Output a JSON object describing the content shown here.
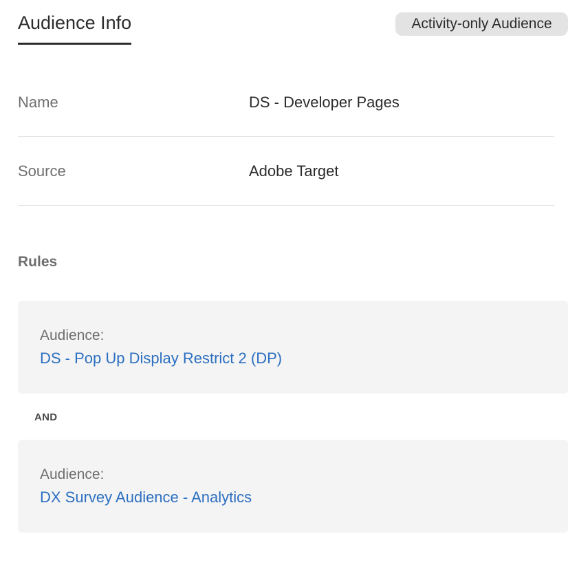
{
  "tab": {
    "label": "Audience Info"
  },
  "badge": {
    "label": "Activity-only Audience"
  },
  "details": {
    "rows": [
      {
        "label": "Name",
        "value": "DS - Developer Pages"
      },
      {
        "label": "Source",
        "value": "Adobe Target"
      }
    ]
  },
  "rules": {
    "heading": "Rules",
    "operator": "AND",
    "items": [
      {
        "label": "Audience:",
        "value": "DS - Pop Up Display Restrict 2 (DP)"
      },
      {
        "label": "Audience:",
        "value": "DX Survey Audience - Analytics"
      }
    ]
  },
  "colors": {
    "link": "#2c6fc1",
    "badge_bg": "#e3e3e3",
    "card_bg": "#f4f4f4",
    "text": "#2c2c2c",
    "muted_text": "#6e6e6e"
  }
}
